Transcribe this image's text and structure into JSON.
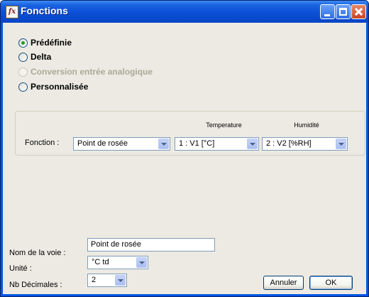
{
  "window": {
    "title": "Fonctions",
    "app_icon": "fx-icon"
  },
  "mode_options": [
    {
      "label": "Prédéfinie",
      "checked": true,
      "disabled": false
    },
    {
      "label": "Delta",
      "checked": false,
      "disabled": false
    },
    {
      "label": "Conversion entrée analogique",
      "checked": false,
      "disabled": true
    },
    {
      "label": "Personnalisée",
      "checked": false,
      "disabled": false
    }
  ],
  "fonction": {
    "label": "Fonction :",
    "selected": "Point de rosée",
    "temperature_header": "Temperature",
    "temperature_value": "1 : V1 [°C]",
    "humidite_header": "Humidité",
    "humidite_value": "2 : V2 [%RH]"
  },
  "channel": {
    "name_label": "Nom de la voie :",
    "name_value": "Point de rosée",
    "unit_label": "Unité :",
    "unit_value": "°C td",
    "decimals_label": "Nb Décimales :",
    "decimals_value": "2"
  },
  "buttons": {
    "cancel": "Annuler",
    "ok": "OK"
  }
}
